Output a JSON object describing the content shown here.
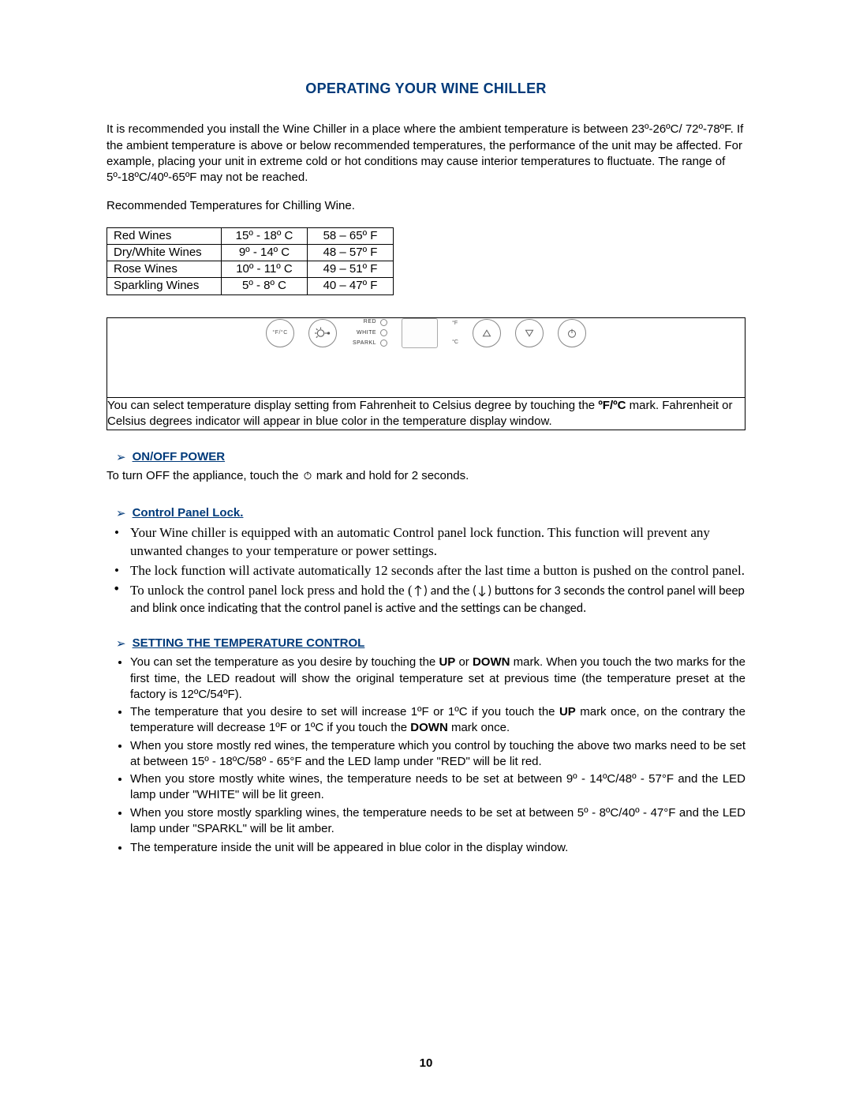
{
  "title": "OPERATING YOUR WINE CHILLER",
  "intro": "It is recommended you install the Wine Chiller in a place where the ambient temperature is between 23º-26ºC/ 72º-78ºF.  If the ambient temperature is above or below recommended temperatures, the performance of the unit may be affected.  For example, placing your unit in extreme cold or hot conditions may cause interior temperatures to fluctuate.  The range of 5º-18ºC/40º-65ºF may not be reached.",
  "rec_label": "Recommended Temperatures for Chilling Wine.",
  "temp_table": [
    {
      "name": "Red Wines",
      "c": "15º - 18º C",
      "f": "58 – 65º F"
    },
    {
      "name": "Dry/White Wines",
      "c": "9º - 14º  C",
      "f": "48 – 57º F"
    },
    {
      "name": "Rose Wines",
      "c": "10º - 11º C",
      "f": "49 – 51º F"
    },
    {
      "name": "Sparkling Wines",
      "c": "5º - 8º  C",
      "f": "40 – 47º F"
    }
  ],
  "panel": {
    "fc_label": "°F/°C",
    "modes": {
      "red": "RED",
      "white": "WHITE",
      "sparkl": "SPARKL"
    },
    "unit_f": "°F",
    "unit_c": "°C"
  },
  "fc_note_a": "You can select temperature display setting from Fahrenheit to Celsius degree by touching the ",
  "fc_note_bold": "ºF/ºC",
  "fc_note_b": " mark.  Fahrenheit or Celsius degrees indicator will appear in blue color in the temperature display window.",
  "onoff": {
    "heading": "ON/OFF POWER",
    "line_a": "To turn OFF the appliance, touch the ",
    "line_b": "  mark and hold  for 2 seconds."
  },
  "lock": {
    "heading": "Control Panel Lock.",
    "b1": "Your Wine chiller is equipped with an automatic Control panel lock function.  This function will prevent any unwanted changes to your temperature or power settings.",
    "b2": "The lock function will activate automatically 12 seconds after the last time a button is pushed on the control panel.",
    "b3a": "To unlock the control panel lock press and hold the (",
    "b3up": "↑",
    "b3b": ") and the (",
    "b3dn": "↓",
    "b3c": ") buttons for 3 seconds the control panel will beep and blink once indicating that the control panel is active and the settings can be changed."
  },
  "set": {
    "heading": "SETTING THE TEMPERATURE CONTROL",
    "items": [
      {
        "a": "You can set the temperature as you desire by touching the ",
        "b1": "UP",
        "c": " or ",
        "b2": "DOWN",
        "d": " mark. When you touch the two marks for the first time, the LED readout will show the original temperature set at previous time (the temperature preset at the factory is 12ºC/54ºF)."
      },
      {
        "a": "The temperature that you desire to set will increase 1ºF or 1ºC if you touch the ",
        "b1": "UP",
        "c": " mark once, on the contrary the temperature will decrease 1ºF or 1ºC if you touch the ",
        "b2": "DOWN",
        "d": " mark once."
      },
      {
        "a": "When you store mostly red wines, the temperature which you control by touching the above two marks need to be set at between 15º - 18ºC/58º - 65°F and the LED lamp under \"RED\" will be lit red."
      },
      {
        "a": "When you store mostly white wines, the temperature needs to be set at between 9º - 14ºC/48º - 57°F and the LED lamp under \"WHITE\" will be lit green."
      },
      {
        "a": "When you store mostly sparkling wines, the temperature needs to be set at between 5º - 8ºC/40º - 47°F and the LED lamp under \"SPARKL\" will be lit amber."
      },
      {
        "a": "The temperature inside the unit will be appeared in blue color in the display window."
      }
    ]
  },
  "page_number": "10"
}
